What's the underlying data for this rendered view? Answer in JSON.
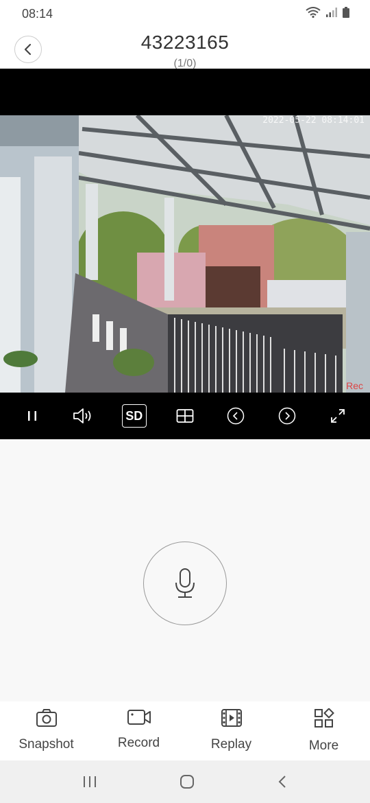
{
  "status_bar": {
    "time": "08:14"
  },
  "header": {
    "title": "43223165",
    "subtitle": "(1/0)"
  },
  "video": {
    "timestamp": "2022-05-22  08:14:01",
    "rec_label": "Rec"
  },
  "controls": {
    "sd_label": "SD"
  },
  "toolbar": {
    "snapshot_label": "Snapshot",
    "record_label": "Record",
    "replay_label": "Replay",
    "more_label": "More"
  }
}
